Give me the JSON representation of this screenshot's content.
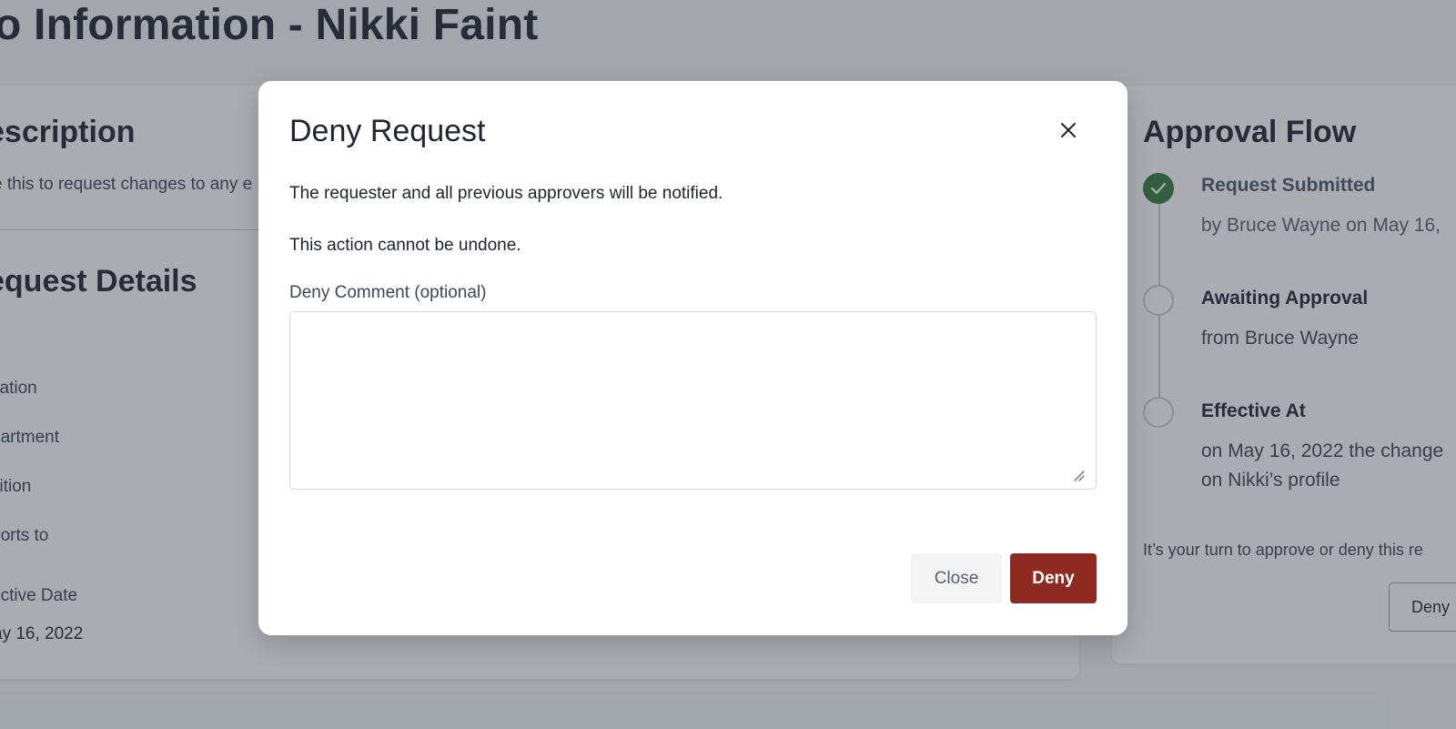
{
  "page": {
    "title": "o Information - Nikki Faint"
  },
  "description": {
    "heading": "escription",
    "text": "e this to request changes to any e"
  },
  "request_details": {
    "heading": "equest Details",
    "labels": [
      "cation",
      "partment",
      "sition",
      "ports to",
      "ective Date"
    ],
    "effective_date_value": "ay 16, 2022"
  },
  "approval_flow": {
    "heading": "Approval Flow",
    "steps": [
      {
        "title": "Request Submitted",
        "subtitle": "by Bruce Wayne on May 16,",
        "status": "done"
      },
      {
        "title": "Awaiting Approval",
        "subtitle": "from Bruce Wayne",
        "status": "pending"
      },
      {
        "title": "Effective At",
        "subtitle": "on May 16, 2022 the change",
        "subtitle2": "on Nikki’s profile",
        "status": "pending"
      }
    ],
    "note": "It’s your turn to approve or deny this re",
    "deny_label": "Deny"
  },
  "modal": {
    "title": "Deny Request",
    "line1": "The requester and all previous approvers will be notified.",
    "line2": "This action cannot be undone.",
    "comment_label": "Deny Comment (optional)",
    "comment_value": "",
    "close_label": "Close",
    "deny_label": "Deny"
  },
  "colors": {
    "deny_button": "#8e2a22",
    "done_step": "#2f7a3a",
    "overlay": "rgba(52, 58, 72, 0.42)"
  },
  "icons": {
    "close": "close-icon",
    "check": "check-icon",
    "resize": "resize-grip-icon"
  }
}
